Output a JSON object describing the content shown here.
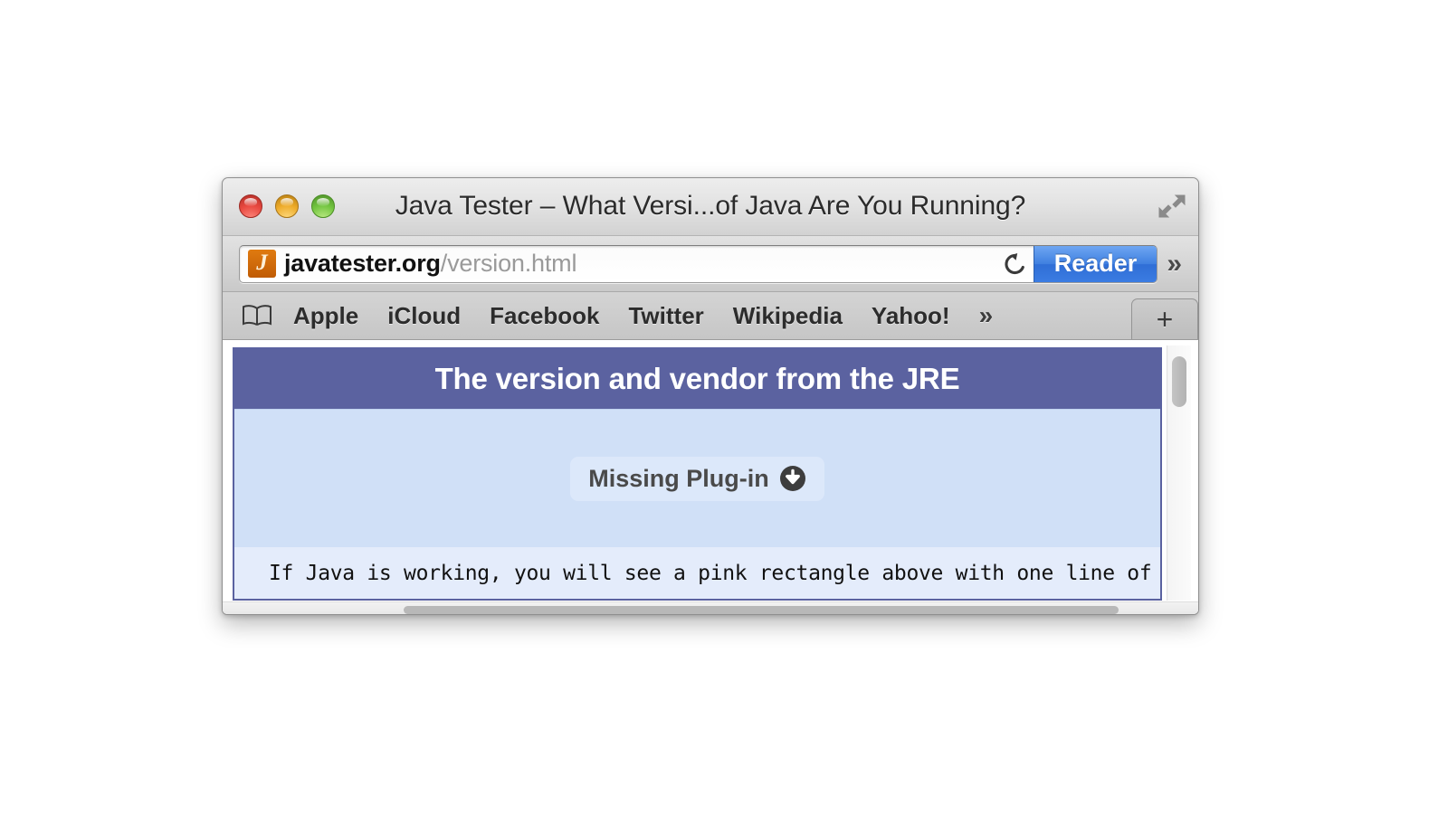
{
  "window": {
    "title": "Java Tester – What Versi...of Java Are You Running?",
    "traffic_lights": [
      {
        "name": "close",
        "color": "#e8483f"
      },
      {
        "name": "minimize",
        "color": "#eeac2b"
      },
      {
        "name": "zoom",
        "color": "#73c540"
      }
    ],
    "fullscreen_icon": "fullscreen-arrows-icon"
  },
  "toolbar": {
    "favicon_letter": "J",
    "favicon_color": "#c05c04",
    "url_host": "javatester.org",
    "url_path": "/version.html",
    "url_full": "javatester.org/version.html",
    "reload_icon": "reload-icon",
    "reader_label": "Reader",
    "reader_color": "#3f7fe0",
    "overflow_label": "»"
  },
  "bookmarks": {
    "book_icon": "open-book-icon",
    "items": [
      {
        "label": "Apple"
      },
      {
        "label": "iCloud"
      },
      {
        "label": "Facebook"
      },
      {
        "label": "Twitter"
      },
      {
        "label": "Wikipedia"
      },
      {
        "label": "Yahoo!"
      }
    ],
    "overflow_label": "»",
    "new_tab_label": "+"
  },
  "page": {
    "header_title": "The version and vendor from the JRE",
    "header_color": "#5b62a0",
    "body_color": "#d0e0f7",
    "plugin": {
      "label": "Missing Plug-in",
      "icon": "download-circle-icon"
    },
    "description": "If Java is working, you will see a pink rectangle above with one line of text"
  }
}
